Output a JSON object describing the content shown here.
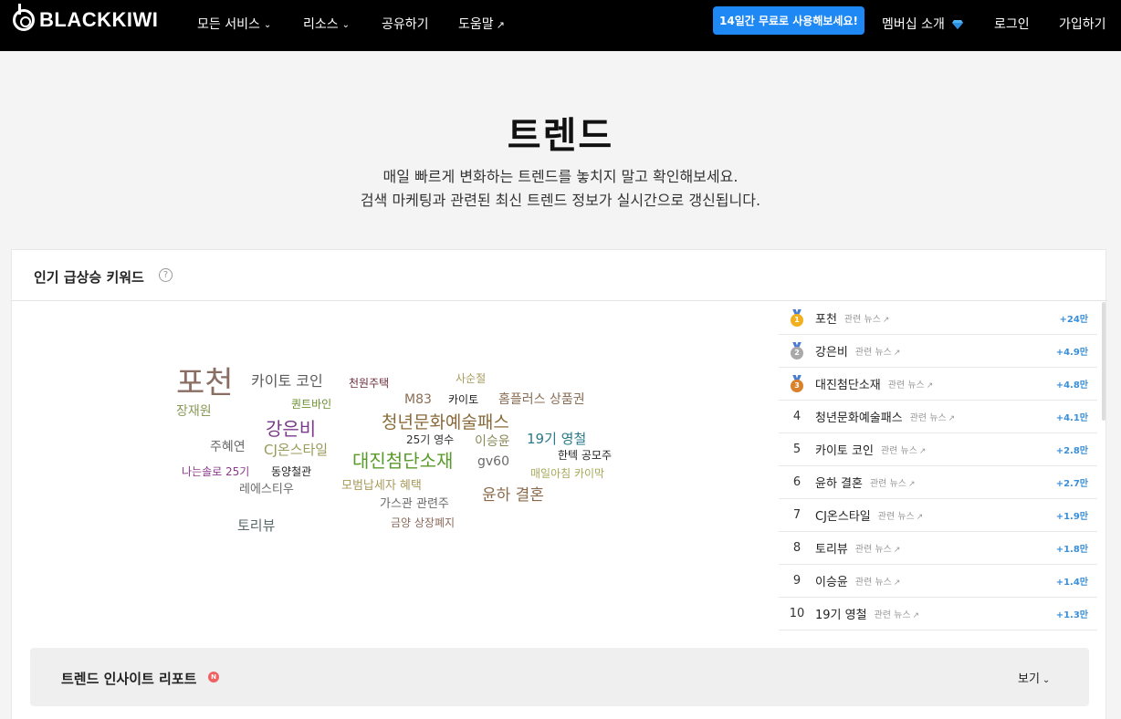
{
  "nav": {
    "logo": "BLACKKIWI",
    "items": [
      {
        "label": "모든 서비스",
        "has_dropdown": true
      },
      {
        "label": "리소스",
        "has_dropdown": true
      },
      {
        "label": "공유하기",
        "has_dropdown": false
      },
      {
        "label": "도움말",
        "external": true
      }
    ],
    "trial_button": "14일간 무료로 사용해보세요!",
    "membership": "멤버십 소개",
    "login": "로그인",
    "signup": "가입하기"
  },
  "hero": {
    "title": "트렌드",
    "subtitle_line1": "매일 빠르게 변화하는 트렌드를 놓치지 말고 확인해보세요.",
    "subtitle_line2": "검색 마케팅과 관련된 최신 트렌드 정보가 실시간으로 갱신됩니다."
  },
  "section": {
    "title": "인기 급상승 키워드",
    "help": "?"
  },
  "word_cloud": [
    {
      "text": "포천",
      "color": "#8a6e63"
    },
    {
      "text": "카이토 코인",
      "color": "#5b5b5b"
    },
    {
      "text": "천원주택",
      "color": "#6b2c3a"
    },
    {
      "text": "사순절",
      "color": "#a69a5a"
    },
    {
      "text": "퀀트바인",
      "color": "#6a8f2e"
    },
    {
      "text": "M83",
      "color": "#8a6e55"
    },
    {
      "text": "카이토",
      "color": "#222222"
    },
    {
      "text": "홈플러스 상품권",
      "color": "#8a6e55"
    },
    {
      "text": "장재원",
      "color": "#8a9a5a"
    },
    {
      "text": "강은비",
      "color": "#7a3a8a"
    },
    {
      "text": "청년문화예술패스",
      "color": "#8a6a3a"
    },
    {
      "text": "19기 영철",
      "color": "#2a7a8a"
    },
    {
      "text": "25기 영수",
      "color": "#333333"
    },
    {
      "text": "이승윤",
      "color": "#8a8a5a"
    },
    {
      "text": "주혜연",
      "color": "#6a6a6a"
    },
    {
      "text": "CJ온스타일",
      "color": "#9a9a5a"
    },
    {
      "text": "대진첨단소재",
      "color": "#5a9a2a"
    },
    {
      "text": "한텍 공모주",
      "color": "#222222"
    },
    {
      "text": "gv60",
      "color": "#6a6a6a"
    },
    {
      "text": "나는솔로 25기",
      "color": "#8a3a8a"
    },
    {
      "text": "동양철관",
      "color": "#222222"
    },
    {
      "text": "매일아침 카이막",
      "color": "#a8a85a"
    },
    {
      "text": "모범납세자 혜택",
      "color": "#a89a5a"
    },
    {
      "text": "레에스티우",
      "color": "#6a6a6a"
    },
    {
      "text": "윤하 결혼",
      "color": "#8a6a4a"
    },
    {
      "text": "가스관 관련주",
      "color": "#6a6a6a"
    },
    {
      "text": "토리뷰",
      "color": "#5a6a6a"
    },
    {
      "text": "금양 상장폐지",
      "color": "#8a6a5a"
    }
  ],
  "ranking": {
    "news_label": "관련 뉴스",
    "items": [
      {
        "rank": "1",
        "keyword": "포천",
        "change": "+24만",
        "medal": "gold"
      },
      {
        "rank": "2",
        "keyword": "강은비",
        "change": "+4.9만",
        "medal": "silver"
      },
      {
        "rank": "3",
        "keyword": "대진첨단소재",
        "change": "+4.8만",
        "medal": "bronze"
      },
      {
        "rank": "4",
        "keyword": "청년문화예술패스",
        "change": "+4.1만",
        "medal": ""
      },
      {
        "rank": "5",
        "keyword": "카이토 코인",
        "change": "+2.8만",
        "medal": ""
      },
      {
        "rank": "6",
        "keyword": "윤하 결혼",
        "change": "+2.7만",
        "medal": ""
      },
      {
        "rank": "7",
        "keyword": "CJ온스타일",
        "change": "+1.9만",
        "medal": ""
      },
      {
        "rank": "8",
        "keyword": "토리뷰",
        "change": "+1.8만",
        "medal": ""
      },
      {
        "rank": "9",
        "keyword": "이승윤",
        "change": "+1.4만",
        "medal": ""
      },
      {
        "rank": "10",
        "keyword": "19기 영철",
        "change": "+1.3만",
        "medal": ""
      }
    ]
  },
  "insight": {
    "title": "트렌드 인사이트 리포트",
    "badge": "N",
    "view_label": "보기"
  },
  "colors": {
    "accent": "#1e88f5",
    "gold": "#f2b01e",
    "silver": "#a9a9a9",
    "bronze": "#d9822b",
    "change": "#3a8fd9"
  }
}
